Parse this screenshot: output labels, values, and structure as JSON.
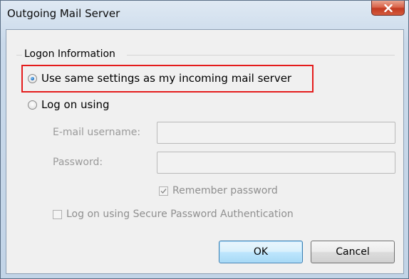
{
  "window": {
    "title": "Outgoing Mail Server",
    "close_glyph": "X"
  },
  "logon_group": {
    "title": "Logon Information"
  },
  "options": {
    "use_same_label": "Use same settings as my incoming mail server",
    "use_same_checked": true,
    "log_on_using_label": "Log on using",
    "log_on_using_checked": false
  },
  "fields": {
    "email_username_label": "E-mail username:",
    "email_username_value": "",
    "password_label": "Password:",
    "password_value": ""
  },
  "checkboxes": {
    "remember_password_label": "Remember password",
    "remember_password_checked": true,
    "spa_label": "Log on using Secure Password Authentication",
    "spa_checked": false
  },
  "buttons": {
    "ok_label": "OK",
    "cancel_label": "Cancel"
  },
  "colors": {
    "highlight": "#e41c1c",
    "close_button": "#c23b22",
    "radio_dot": "#1c6fc0"
  },
  "icons": {
    "close": "close-icon",
    "checkmark": "checkmark-icon"
  }
}
